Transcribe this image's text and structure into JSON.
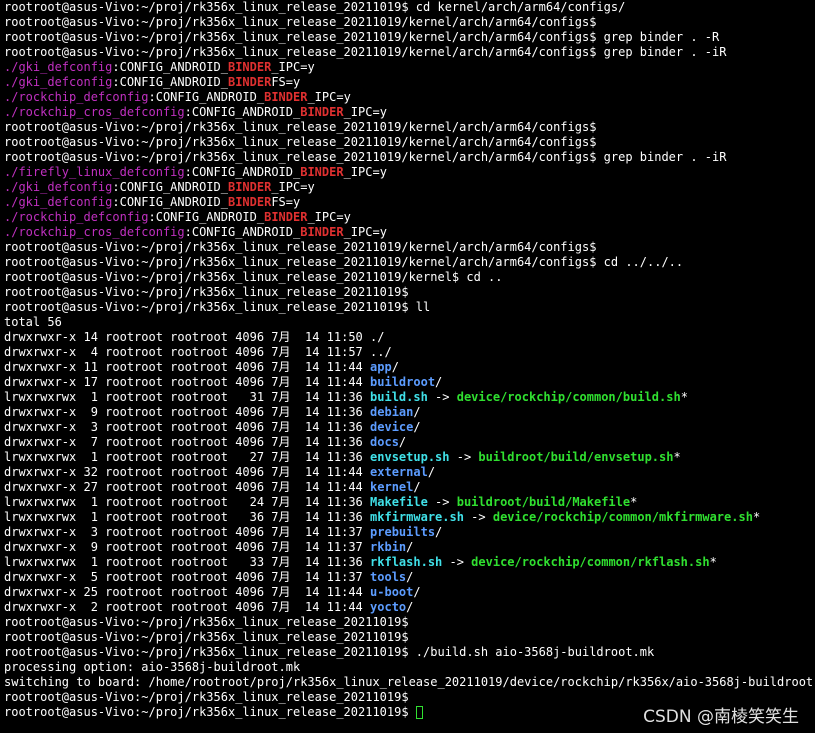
{
  "terminal": {
    "lines": [
      [
        {
          "t": "rootroot@asus-Vivo:~/proj/rk356x_linux_release_20211019$ cd kernel/arch/arm64/configs/"
        }
      ],
      [
        {
          "t": "rootroot@asus-Vivo:~/proj/rk356x_linux_release_20211019/kernel/arch/arm64/configs$"
        }
      ],
      [
        {
          "t": "rootroot@asus-Vivo:~/proj/rk356x_linux_release_20211019/kernel/arch/arm64/configs$ grep binder . -R"
        }
      ],
      [
        {
          "t": "rootroot@asus-Vivo:~/proj/rk356x_linux_release_20211019/kernel/arch/arm64/configs$ grep binder . -iR"
        }
      ],
      [
        {
          "t": "./gki_defconfig",
          "s": "mag"
        },
        {
          "t": ":CONFIG_ANDROID_"
        },
        {
          "t": "BINDER",
          "s": "red"
        },
        {
          "t": "_IPC=y"
        }
      ],
      [
        {
          "t": "./gki_defconfig",
          "s": "mag"
        },
        {
          "t": ":CONFIG_ANDROID_"
        },
        {
          "t": "BINDER",
          "s": "red"
        },
        {
          "t": "FS=y"
        }
      ],
      [
        {
          "t": "./rockchip_defconfig",
          "s": "mag"
        },
        {
          "t": ":CONFIG_ANDROID_"
        },
        {
          "t": "BINDER",
          "s": "red"
        },
        {
          "t": "_IPC=y"
        }
      ],
      [
        {
          "t": "./rockchip_cros_defconfig",
          "s": "mag"
        },
        {
          "t": ":CONFIG_ANDROID_"
        },
        {
          "t": "BINDER",
          "s": "red"
        },
        {
          "t": "_IPC=y"
        }
      ],
      [
        {
          "t": "rootroot@asus-Vivo:~/proj/rk356x_linux_release_20211019/kernel/arch/arm64/configs$"
        }
      ],
      [
        {
          "t": "rootroot@asus-Vivo:~/proj/rk356x_linux_release_20211019/kernel/arch/arm64/configs$"
        }
      ],
      [
        {
          "t": "rootroot@asus-Vivo:~/proj/rk356x_linux_release_20211019/kernel/arch/arm64/configs$ grep binder . -iR"
        }
      ],
      [
        {
          "t": "./firefly_linux_defconfig",
          "s": "mag"
        },
        {
          "t": ":CONFIG_ANDROID_"
        },
        {
          "t": "BINDER",
          "s": "red"
        },
        {
          "t": "_IPC=y"
        }
      ],
      [
        {
          "t": "./gki_defconfig",
          "s": "mag"
        },
        {
          "t": ":CONFIG_ANDROID_"
        },
        {
          "t": "BINDER",
          "s": "red"
        },
        {
          "t": "_IPC=y"
        }
      ],
      [
        {
          "t": "./gki_defconfig",
          "s": "mag"
        },
        {
          "t": ":CONFIG_ANDROID_"
        },
        {
          "t": "BINDER",
          "s": "red"
        },
        {
          "t": "FS=y"
        }
      ],
      [
        {
          "t": "./rockchip_defconfig",
          "s": "mag"
        },
        {
          "t": ":CONFIG_ANDROID_"
        },
        {
          "t": "BINDER",
          "s": "red"
        },
        {
          "t": "_IPC=y"
        }
      ],
      [
        {
          "t": "./rockchip_cros_defconfig",
          "s": "mag"
        },
        {
          "t": ":CONFIG_ANDROID_"
        },
        {
          "t": "BINDER",
          "s": "red"
        },
        {
          "t": "_IPC=y"
        }
      ],
      [
        {
          "t": "rootroot@asus-Vivo:~/proj/rk356x_linux_release_20211019/kernel/arch/arm64/configs$"
        }
      ],
      [
        {
          "t": "rootroot@asus-Vivo:~/proj/rk356x_linux_release_20211019/kernel/arch/arm64/configs$ cd ../../.."
        }
      ],
      [
        {
          "t": "rootroot@asus-Vivo:~/proj/rk356x_linux_release_20211019/kernel$ cd .."
        }
      ],
      [
        {
          "t": "rootroot@asus-Vivo:~/proj/rk356x_linux_release_20211019$"
        }
      ],
      [
        {
          "t": "rootroot@asus-Vivo:~/proj/rk356x_linux_release_20211019$ ll"
        }
      ],
      [
        {
          "t": "total 56"
        }
      ],
      [
        {
          "t": "drwxrwxr-x 14 rootroot rootroot 4096 7月  14 11:50 ./"
        }
      ],
      [
        {
          "t": "drwxrwxr-x  4 rootroot rootroot 4096 7月  14 11:57 ../"
        }
      ],
      [
        {
          "t": "drwxrwxr-x 11 rootroot rootroot 4096 7月  14 11:44 "
        },
        {
          "t": "app",
          "s": "blue"
        },
        {
          "t": "/"
        }
      ],
      [
        {
          "t": "drwxrwxr-x 17 rootroot rootroot 4096 7月  14 11:44 "
        },
        {
          "t": "buildroot",
          "s": "blue"
        },
        {
          "t": "/"
        }
      ],
      [
        {
          "t": "lrwxrwxrwx  1 rootroot rootroot   31 7月  14 11:36 "
        },
        {
          "t": "build.sh",
          "s": "cyan"
        },
        {
          "t": " -> "
        },
        {
          "t": "device/rockchip/common/build.sh",
          "s": "green"
        },
        {
          "t": "*"
        }
      ],
      [
        {
          "t": "drwxrwxr-x  9 rootroot rootroot 4096 7月  14 11:36 "
        },
        {
          "t": "debian",
          "s": "blue"
        },
        {
          "t": "/"
        }
      ],
      [
        {
          "t": "drwxrwxr-x  3 rootroot rootroot 4096 7月  14 11:36 "
        },
        {
          "t": "device",
          "s": "blue"
        },
        {
          "t": "/"
        }
      ],
      [
        {
          "t": "drwxrwxr-x  7 rootroot rootroot 4096 7月  14 11:36 "
        },
        {
          "t": "docs",
          "s": "blue"
        },
        {
          "t": "/"
        }
      ],
      [
        {
          "t": "lrwxrwxrwx  1 rootroot rootroot   27 7月  14 11:36 "
        },
        {
          "t": "envsetup.sh",
          "s": "cyan"
        },
        {
          "t": " -> "
        },
        {
          "t": "buildroot/build/envsetup.sh",
          "s": "green"
        },
        {
          "t": "*"
        }
      ],
      [
        {
          "t": "drwxrwxr-x 32 rootroot rootroot 4096 7月  14 11:44 "
        },
        {
          "t": "external",
          "s": "blue"
        },
        {
          "t": "/"
        }
      ],
      [
        {
          "t": "drwxrwxr-x 27 rootroot rootroot 4096 7月  14 11:44 "
        },
        {
          "t": "kernel",
          "s": "blue"
        },
        {
          "t": "/"
        }
      ],
      [
        {
          "t": "lrwxrwxrwx  1 rootroot rootroot   24 7月  14 11:36 "
        },
        {
          "t": "Makefile",
          "s": "cyan"
        },
        {
          "t": " -> "
        },
        {
          "t": "buildroot/build/Makefile",
          "s": "green"
        },
        {
          "t": "*"
        }
      ],
      [
        {
          "t": "lrwxrwxrwx  1 rootroot rootroot   36 7月  14 11:36 "
        },
        {
          "t": "mkfirmware.sh",
          "s": "cyan"
        },
        {
          "t": " -> "
        },
        {
          "t": "device/rockchip/common/mkfirmware.sh",
          "s": "green"
        },
        {
          "t": "*"
        }
      ],
      [
        {
          "t": "drwxrwxr-x  3 rootroot rootroot 4096 7月  14 11:37 "
        },
        {
          "t": "prebuilts",
          "s": "blue"
        },
        {
          "t": "/"
        }
      ],
      [
        {
          "t": "drwxrwxr-x  9 rootroot rootroot 4096 7月  14 11:37 "
        },
        {
          "t": "rkbin",
          "s": "blue"
        },
        {
          "t": "/"
        }
      ],
      [
        {
          "t": "lrwxrwxrwx  1 rootroot rootroot   33 7月  14 11:36 "
        },
        {
          "t": "rkflash.sh",
          "s": "cyan"
        },
        {
          "t": " -> "
        },
        {
          "t": "device/rockchip/common/rkflash.sh",
          "s": "green"
        },
        {
          "t": "*"
        }
      ],
      [
        {
          "t": "drwxrwxr-x  5 rootroot rootroot 4096 7月  14 11:37 "
        },
        {
          "t": "tools",
          "s": "blue"
        },
        {
          "t": "/"
        }
      ],
      [
        {
          "t": "drwxrwxr-x 25 rootroot rootroot 4096 7月  14 11:44 "
        },
        {
          "t": "u-boot",
          "s": "blue"
        },
        {
          "t": "/"
        }
      ],
      [
        {
          "t": "drwxrwxr-x  2 rootroot rootroot 4096 7月  14 11:44 "
        },
        {
          "t": "yocto",
          "s": "blue"
        },
        {
          "t": "/"
        }
      ],
      [
        {
          "t": "rootroot@asus-Vivo:~/proj/rk356x_linux_release_20211019$"
        }
      ],
      [
        {
          "t": "rootroot@asus-Vivo:~/proj/rk356x_linux_release_20211019$"
        }
      ],
      [
        {
          "t": "rootroot@asus-Vivo:~/proj/rk356x_linux_release_20211019$ ./build.sh aio-3568j-buildroot.mk"
        }
      ],
      [
        {
          "t": "processing option: aio-3568j-buildroot.mk"
        }
      ],
      [
        {
          "t": "switching to board: /home/rootroot/proj/rk356x_linux_release_20211019/device/rockchip/rk356x/aio-3568j-buildroot.mk"
        }
      ],
      [
        {
          "t": "rootroot@asus-Vivo:~/proj/rk356x_linux_release_20211019$"
        }
      ],
      [
        {
          "t": "rootroot@asus-Vivo:~/proj/rk356x_linux_release_20211019$ "
        },
        {
          "cursor": true
        }
      ]
    ]
  },
  "watermark": "CSDN @南棱笑笑生",
  "colors": {
    "background": "#000000",
    "text": "#ffffff",
    "file_match": "#c030c0",
    "match_highlight": "#e03030",
    "directory": "#5c9cff",
    "symlink": "#40e0e8",
    "executable": "#30e030"
  }
}
